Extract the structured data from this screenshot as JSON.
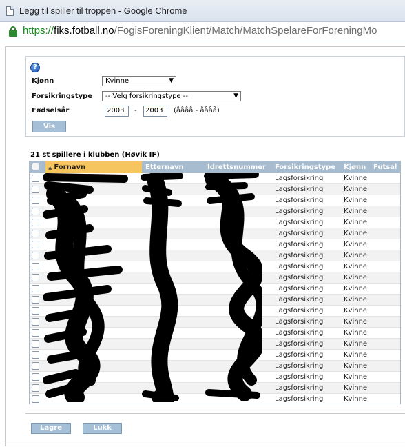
{
  "window": {
    "title": "Legg til spiller til troppen - Google Chrome",
    "url_scheme": "https://",
    "url_host": "fiks.fotball.no",
    "url_path": "/FogisForeningKlient/Match/MatchSpelareForForeningMo"
  },
  "filter": {
    "kjonn_label": "Kjønn",
    "kjonn_value": "Kvinne",
    "forsikring_label": "Forsikringstype",
    "forsikring_value": "-- Velg forsikringstype --",
    "fodselsar_label": "Fødselsår",
    "year_from": "2003",
    "year_sep": "-",
    "year_to": "2003",
    "year_hint": "(åååå - åååå)",
    "vis_button": "Vis",
    "help_glyph": "?"
  },
  "table": {
    "caption": "21 st spillere i klubben (Høvik IF)",
    "columns": [
      "Fornavn",
      "Etternavn",
      "Idrettsnummer",
      "Forsikringstype",
      "Kjønn",
      "Futsal"
    ],
    "rows": [
      {
        "fornavn": "",
        "etternavn": "",
        "idrettsnummer": "",
        "forsikringstype": "Lagsforsikring",
        "kjonn": "Kvinne"
      },
      {
        "fornavn": "",
        "etternavn": "",
        "idrettsnummer": "",
        "forsikringstype": "Lagsforsikring",
        "kjonn": "Kvinne"
      },
      {
        "fornavn": "",
        "etternavn": "",
        "idrettsnummer": "",
        "forsikringstype": "Lagsforsikring",
        "kjonn": "Kvinne"
      },
      {
        "fornavn": "",
        "etternavn": "",
        "idrettsnummer": "",
        "forsikringstype": "Lagsforsikring",
        "kjonn": "Kvinne"
      },
      {
        "fornavn": "",
        "etternavn": "",
        "idrettsnummer": "",
        "forsikringstype": "Lagsforsikring",
        "kjonn": "Kvinne"
      },
      {
        "fornavn": "",
        "etternavn": "",
        "idrettsnummer": "",
        "forsikringstype": "Lagsforsikring",
        "kjonn": "Kvinne"
      },
      {
        "fornavn": "",
        "etternavn": "",
        "idrettsnummer": "",
        "forsikringstype": "Lagsforsikring",
        "kjonn": "Kvinne"
      },
      {
        "fornavn": "",
        "etternavn": "",
        "idrettsnummer": "",
        "forsikringstype": "Lagsforsikring",
        "kjonn": "Kvinne"
      },
      {
        "fornavn": "",
        "etternavn": "",
        "idrettsnummer": "",
        "forsikringstype": "Lagsforsikring",
        "kjonn": "Kvinne"
      },
      {
        "fornavn": "",
        "etternavn": "",
        "idrettsnummer": "",
        "forsikringstype": "Lagsforsikring",
        "kjonn": "Kvinne"
      },
      {
        "fornavn": "",
        "etternavn": "",
        "idrettsnummer": "",
        "forsikringstype": "Lagsforsikring",
        "kjonn": "Kvinne"
      },
      {
        "fornavn": "",
        "etternavn": "",
        "idrettsnummer": "",
        "forsikringstype": "Lagsforsikring",
        "kjonn": "Kvinne"
      },
      {
        "fornavn": "",
        "etternavn": "",
        "idrettsnummer": "",
        "forsikringstype": "Lagsforsikring",
        "kjonn": "Kvinne"
      },
      {
        "fornavn": "",
        "etternavn": "",
        "idrettsnummer": "",
        "forsikringstype": "Lagsforsikring",
        "kjonn": "Kvinne"
      },
      {
        "fornavn": "",
        "etternavn": "",
        "idrettsnummer": "",
        "forsikringstype": "Lagsforsikring",
        "kjonn": "Kvinne"
      },
      {
        "fornavn": "",
        "etternavn": "",
        "idrettsnummer": "",
        "forsikringstype": "Lagsforsikring",
        "kjonn": "Kvinne"
      },
      {
        "fornavn": "",
        "etternavn": "",
        "idrettsnummer": "",
        "forsikringstype": "Lagsforsikring",
        "kjonn": "Kvinne"
      },
      {
        "fornavn": "",
        "etternavn": "",
        "idrettsnummer": "",
        "forsikringstype": "Lagsforsikring",
        "kjonn": "Kvinne"
      },
      {
        "fornavn": "",
        "etternavn": "",
        "idrettsnummer": "",
        "forsikringstype": "Lagsforsikring",
        "kjonn": "Kvinne"
      },
      {
        "fornavn": "",
        "etternavn": "",
        "idrettsnummer": "",
        "forsikringstype": "Lagsforsikring",
        "kjonn": "Kvinne"
      },
      {
        "fornavn": "",
        "etternavn": "",
        "idrettsnummer": "",
        "forsikringstype": "Lagsforsikring",
        "kjonn": "Kvinne"
      }
    ]
  },
  "footer": {
    "lagre_button": "Lagre",
    "lukk_button": "Lukk"
  },
  "colors": {
    "header_bg": "#a7bccf",
    "sorted_header_bg": "#f6c560",
    "button_bg": "#a5bfd6",
    "secure_green": "#1c8b1c",
    "redaction": "#000000"
  }
}
